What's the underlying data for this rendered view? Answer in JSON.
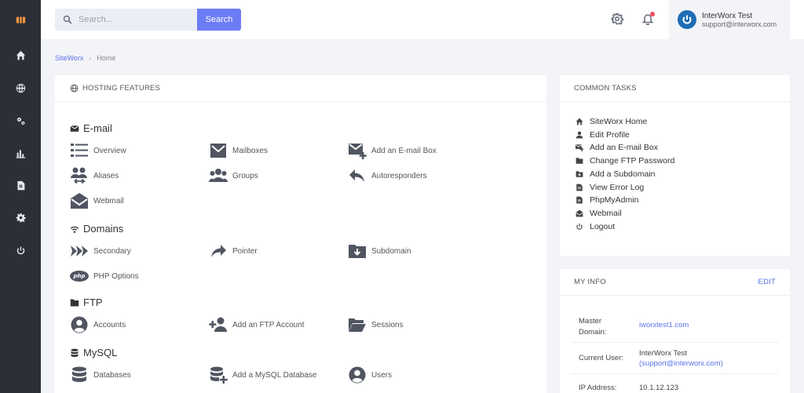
{
  "search": {
    "placeholder": "Search...",
    "button": "Search"
  },
  "user": {
    "name": "InterWorx Test",
    "email": "support@interworx.com"
  },
  "breadcrumb": {
    "root": "SiteWorx",
    "separator": "›",
    "current": "Home"
  },
  "hosting": {
    "title": "HOSTING FEATURES",
    "sections": {
      "email": {
        "title": "E-mail",
        "items": [
          "Overview",
          "Mailboxes",
          "Add an E-mail Box",
          "Aliases",
          "Groups",
          "Autoresponders",
          "Webmail"
        ]
      },
      "domains": {
        "title": "Domains",
        "items": [
          "Secondary",
          "Pointer",
          "Subdomain",
          "PHP Options"
        ]
      },
      "ftp": {
        "title": "FTP",
        "items": [
          "Accounts",
          "Add an FTP Account",
          "Sessions"
        ]
      },
      "mysql": {
        "title": "MySQL",
        "items": [
          "Databases",
          "Add a MySQL Database",
          "Users"
        ]
      }
    },
    "php_badge": "php"
  },
  "tasks": {
    "title": "COMMON TASKS",
    "items": [
      "SiteWorx Home",
      "Edit Profile",
      "Add an E-mail Box",
      "Change FTP Password",
      "Add a Subdomain",
      "View Error Log",
      "PhpMyAdmin",
      "Webmail",
      "Logout"
    ]
  },
  "myinfo": {
    "title": "MY INFO",
    "edit": "EDIT",
    "master_label_1": "Master",
    "master_label_2": "Domain:",
    "master_value": "iworxtest1.com",
    "user_label": "Current User:",
    "user_name": "InterWorx Test",
    "user_email": "(support@interworx.com)",
    "ip_label": "IP Address:",
    "ip_value": "10.1.12.123"
  },
  "colors": {
    "accent": "#6c7cf5",
    "sidebar": "#2b2f38",
    "logo": "#f2963b",
    "link": "#5a72e8"
  }
}
